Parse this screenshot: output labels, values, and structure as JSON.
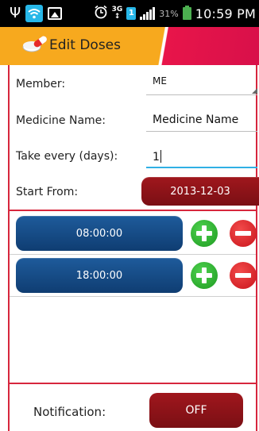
{
  "status_bar": {
    "network": "3G",
    "sim": "1",
    "battery_percent": "31%",
    "time": "10:59 PM",
    "icons": [
      "usb-icon",
      "wifi-icon",
      "image-icon",
      "alarm-icon",
      "network-3g-icon",
      "sim-icon",
      "signal-icon",
      "battery-icon"
    ]
  },
  "header": {
    "title": "Edit Doses",
    "accent_color": "#f7a91e",
    "secondary_color": "#e8154a"
  },
  "form": {
    "member_label": "Member:",
    "member_value": "ME",
    "medicine_name_label": "Medicine Name:",
    "medicine_name_value": "Medicine Name",
    "take_every_label": "Take every (days):",
    "take_every_value": "1",
    "start_from_label": "Start From:",
    "start_date": "2013-12-03"
  },
  "doses": [
    {
      "time": "08:00:00"
    },
    {
      "time": "18:00:00"
    }
  ],
  "notification": {
    "label": "Notification:",
    "state": "OFF"
  },
  "colors": {
    "time_button": "#1e5b9b",
    "date_button": "#a0171d",
    "add": "#2bb32e",
    "remove": "#e0262c",
    "frame": "#d7263d"
  }
}
